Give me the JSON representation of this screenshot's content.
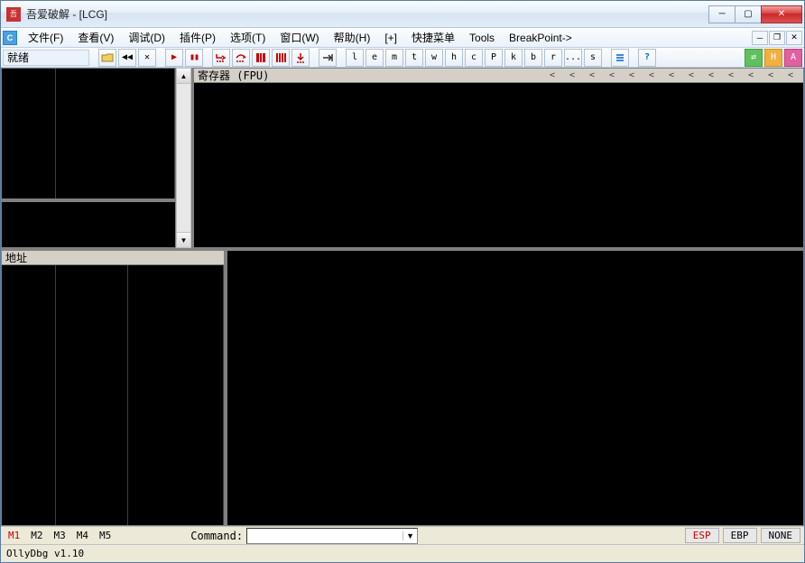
{
  "window": {
    "title": "吾爱破解 - [LCG]"
  },
  "menu": {
    "file": "文件(F)",
    "view": "查看(V)",
    "debug": "调试(D)",
    "plugins": "插件(P)",
    "options": "选项(T)",
    "window": "窗口(W)",
    "help": "帮助(H)",
    "plus": "[+]",
    "quickmenu": "快捷菜单",
    "tools": "Tools",
    "breakpoint": "BreakPoint->"
  },
  "toolbar": {
    "status_ready": "就绪",
    "letters": [
      "l",
      "e",
      "m",
      "t",
      "w",
      "h",
      "c",
      "P",
      "k",
      "b",
      "r",
      "...",
      "s"
    ]
  },
  "panes": {
    "registers_label": "寄存器 (FPU)",
    "address_label": "地址"
  },
  "cmdbar": {
    "tabs": [
      "M1",
      "M2",
      "M3",
      "M4",
      "M5"
    ],
    "command_label": "Command:",
    "esp": "ESP",
    "ebp": "EBP",
    "none": "NONE"
  },
  "status": {
    "version": "OllyDbg v1.10"
  }
}
